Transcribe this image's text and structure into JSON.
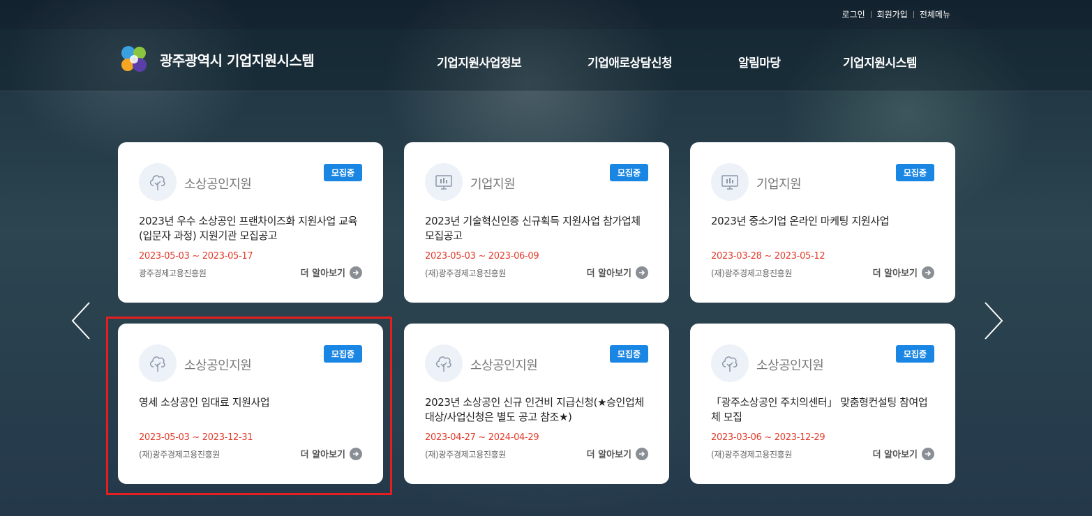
{
  "util": {
    "login": "로그인",
    "signup": "회원가입",
    "allmenu": "전체메뉴"
  },
  "header": {
    "site_title": "광주광역시 기업지원시스템"
  },
  "nav": [
    "기업지원사업정보",
    "기업애로상담신청",
    "알림마당",
    "기업지원시스템"
  ],
  "cards": [
    {
      "category": "소상공인지원",
      "category_icon": "tree-icon",
      "badge": "모집중",
      "title": "2023년 우수 소상공인 프랜차이즈화 지원사업 교육(입문자 과정) 지원기관 모집공고",
      "date": "2023-05-03 ~ 2023-05-17",
      "org": "광주경제고용진흥원",
      "more": "더 알아보기"
    },
    {
      "category": "기업지원",
      "category_icon": "monitor-chart-icon",
      "badge": "모집중",
      "title": "2023년 기술혁신인증 신규획득 지원사업 참가업체 모집공고",
      "date": "2023-05-03 ~ 2023-06-09",
      "org": "(재)광주경제고용진흥원",
      "more": "더 알아보기"
    },
    {
      "category": "기업지원",
      "category_icon": "monitor-chart-icon",
      "badge": "모집중",
      "title": "2023년 중소기업 온라인 마케팅 지원사업",
      "date": "2023-03-28 ~ 2023-05-12",
      "org": "(재)광주경제고용진흥원",
      "more": "더 알아보기"
    },
    {
      "category": "소상공인지원",
      "category_icon": "tree-icon",
      "badge": "모집중",
      "title": "영세 소상공인 임대료 지원사업",
      "date": "2023-05-03 ~ 2023-12-31",
      "org": "(재)광주경제고용진흥원",
      "more": "더 알아보기"
    },
    {
      "category": "소상공인지원",
      "category_icon": "tree-icon",
      "badge": "모집중",
      "title": "2023년 소상공인 신규 인건비 지급신청(★승인업체 대상/사업신청은 별도 공고 참조★)",
      "date": "2023-04-27 ~ 2024-04-29",
      "org": "(재)광주경제고용진흥원",
      "more": "더 알아보기"
    },
    {
      "category": "소상공인지원",
      "category_icon": "tree-icon",
      "badge": "모집중",
      "title": "「광주소상공인 주치의센터」 맞춤형컨설팅 참여업체 모집",
      "date": "2023-03-06 ~ 2023-12-29",
      "org": "(재)광주경제고용진흥원",
      "more": "더 알아보기"
    }
  ],
  "colors": {
    "badge": "#1a86e4",
    "date": "#e23a2a",
    "highlight": "#e61e1e"
  }
}
